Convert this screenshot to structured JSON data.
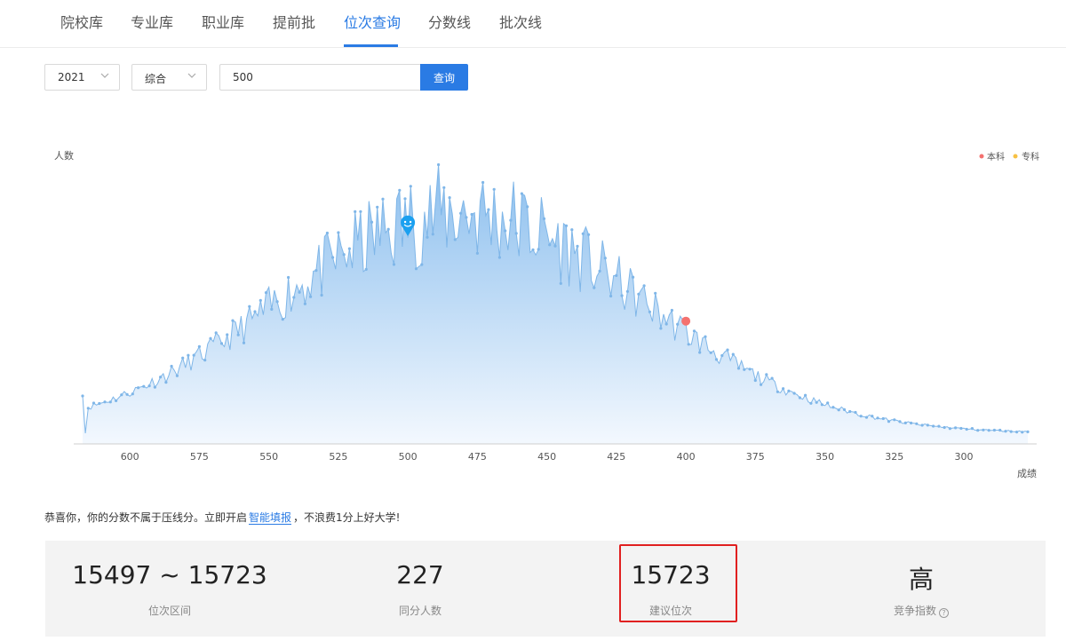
{
  "nav": {
    "items": [
      "院校库",
      "专业库",
      "职业库",
      "提前批",
      "位次查询",
      "分数线",
      "批次线"
    ],
    "active_index": 4
  },
  "filters": {
    "year": "2021",
    "subject": "综合",
    "score_value": "500",
    "query_label": "查询"
  },
  "chart_data": {
    "type": "area",
    "ylabel": "人数",
    "xlabel": "成绩",
    "x_ticks": [
      600,
      575,
      550,
      525,
      500,
      475,
      450,
      425,
      400,
      375,
      350,
      325,
      300
    ],
    "x_range": [
      617,
      277
    ],
    "x_reversed": true,
    "legend": [
      {
        "name": "本科",
        "color": "#f4716f"
      },
      {
        "name": "专科",
        "color": "#f7c143"
      }
    ],
    "legend_position": "top-right",
    "marker_score": 500,
    "undergrad_line_score": 400,
    "y_axis_labels_visible": false,
    "colors": {
      "line": "#7fb6e8",
      "area_top": "#8cbfee",
      "area_bottom": "#f3f8fe",
      "marker": "#1aa0f0",
      "dot": "#f4716f"
    }
  },
  "notice": {
    "prefix": "恭喜你，你的分数不属于压线分。立即开启",
    "link": "智能填报",
    "suffix": "，不浪费1分上好大学!"
  },
  "stats": [
    {
      "value": "15497 ~ 15723",
      "label": "位次区间"
    },
    {
      "value": "227",
      "label": "同分人数"
    },
    {
      "value": "15723",
      "label": "建议位次"
    },
    {
      "value": "高",
      "label": "竞争指数"
    }
  ]
}
